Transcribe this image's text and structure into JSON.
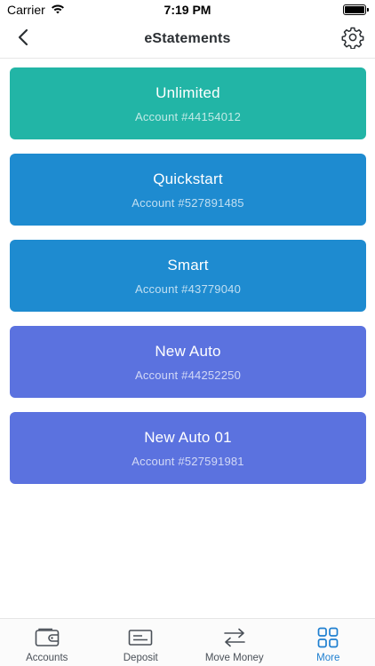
{
  "status_bar": {
    "carrier": "Carrier",
    "time": "7:19 PM"
  },
  "nav": {
    "title": "eStatements"
  },
  "accounts": [
    {
      "name": "Unlimited",
      "number": "Account #44154012",
      "color": "#22b5a6"
    },
    {
      "name": "Quickstart",
      "number": "Account #527891485",
      "color": "#1e8bd0"
    },
    {
      "name": "Smart",
      "number": "Account #43779040",
      "color": "#1e8bd0"
    },
    {
      "name": "New Auto",
      "number": "Account #44252250",
      "color": "#5b72df"
    },
    {
      "name": "New Auto 01",
      "number": "Account #527591981",
      "color": "#5b72df"
    }
  ],
  "tabs": [
    {
      "label": "Accounts",
      "icon": "wallet-icon",
      "active": false
    },
    {
      "label": "Deposit",
      "icon": "check-deposit-icon",
      "active": false
    },
    {
      "label": "Move Money",
      "icon": "transfer-arrows-icon",
      "active": false
    },
    {
      "label": "More",
      "icon": "grid-icon",
      "active": true
    }
  ],
  "colors": {
    "accent": "#1e7fd0",
    "tab_inactive": "#4a5058"
  }
}
